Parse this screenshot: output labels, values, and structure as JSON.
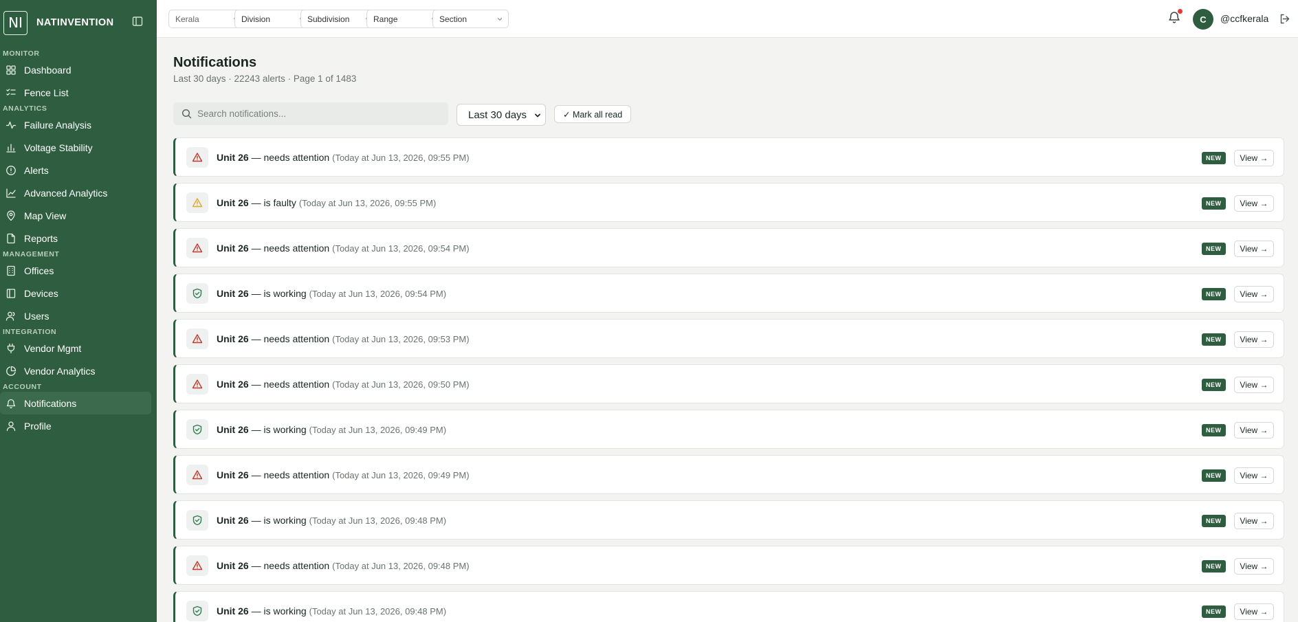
{
  "app": {
    "brand_initials": "NI",
    "brand_name": "NATINVENTION"
  },
  "sidebar": {
    "sections": [
      {
        "label": "MONITOR",
        "items": [
          {
            "label": "Dashboard",
            "icon": "dashboard-icon"
          },
          {
            "label": "Fence List",
            "icon": "list-check-icon"
          }
        ]
      },
      {
        "label": "ANALYTICS",
        "items": [
          {
            "label": "Failure Analysis",
            "icon": "activity-icon"
          },
          {
            "label": "Voltage Stability",
            "icon": "bar-chart-icon"
          },
          {
            "label": "Alerts",
            "icon": "alert-circle-icon"
          },
          {
            "label": "Advanced Analytics",
            "icon": "line-chart-icon"
          },
          {
            "label": "Map View",
            "icon": "map-pin-icon"
          },
          {
            "label": "Reports",
            "icon": "file-icon"
          }
        ]
      },
      {
        "label": "MANAGEMENT",
        "items": [
          {
            "label": "Offices",
            "icon": "building-icon"
          },
          {
            "label": "Devices",
            "icon": "device-icon"
          },
          {
            "label": "Users",
            "icon": "users-icon"
          }
        ]
      },
      {
        "label": "INTEGRATION",
        "items": [
          {
            "label": "Vendor Mgmt",
            "icon": "plug-icon"
          },
          {
            "label": "Vendor Analytics",
            "icon": "pie-chart-icon"
          }
        ]
      },
      {
        "label": "ACCOUNT",
        "items": [
          {
            "label": "Notifications",
            "icon": "bell-icon",
            "active": true
          },
          {
            "label": "Profile",
            "icon": "user-icon"
          }
        ]
      }
    ]
  },
  "topbar": {
    "filters": [
      {
        "label": "Kerala",
        "muted": true
      },
      {
        "label": "Division"
      },
      {
        "label": "Subdivision"
      },
      {
        "label": "Range"
      },
      {
        "label": "Section"
      }
    ],
    "avatar_initial": "C",
    "username": "@ccfkerala"
  },
  "main": {
    "title": "Notifications",
    "subtitle": "Last 30 days · 22243 alerts · Page 1 of 1483",
    "search_placeholder": "Search notifications...",
    "range_selected": "Last 30 days",
    "mark_all_label": "✓ Mark all read"
  },
  "colors": {
    "sidebar": "#2e5e3f",
    "danger": "#c0392b",
    "warning": "#e0a82e",
    "ok": "#2e7d4f"
  },
  "notifications": [
    {
      "unit": "Unit 26",
      "message": "— needs attention",
      "time": "(Today at Jun 13, 2026, 09:55 PM)",
      "kind": "danger",
      "badge": "NEW",
      "action": "View →"
    },
    {
      "unit": "Unit 26",
      "message": "— is faulty",
      "time": "(Today at Jun 13, 2026, 09:55 PM)",
      "kind": "warning",
      "badge": "NEW",
      "action": "View →"
    },
    {
      "unit": "Unit 26",
      "message": "— needs attention",
      "time": "(Today at Jun 13, 2026, 09:54 PM)",
      "kind": "danger",
      "badge": "NEW",
      "action": "View →"
    },
    {
      "unit": "Unit 26",
      "message": "— is working",
      "time": "(Today at Jun 13, 2026, 09:54 PM)",
      "kind": "ok",
      "badge": "NEW",
      "action": "View →"
    },
    {
      "unit": "Unit 26",
      "message": "— needs attention",
      "time": "(Today at Jun 13, 2026, 09:53 PM)",
      "kind": "danger",
      "badge": "NEW",
      "action": "View →"
    },
    {
      "unit": "Unit 26",
      "message": "— needs attention",
      "time": "(Today at Jun 13, 2026, 09:50 PM)",
      "kind": "danger",
      "badge": "NEW",
      "action": "View →"
    },
    {
      "unit": "Unit 26",
      "message": "— is working",
      "time": "(Today at Jun 13, 2026, 09:49 PM)",
      "kind": "ok",
      "badge": "NEW",
      "action": "View →"
    },
    {
      "unit": "Unit 26",
      "message": "— needs attention",
      "time": "(Today at Jun 13, 2026, 09:49 PM)",
      "kind": "danger",
      "badge": "NEW",
      "action": "View →"
    },
    {
      "unit": "Unit 26",
      "message": "— is working",
      "time": "(Today at Jun 13, 2026, 09:48 PM)",
      "kind": "ok",
      "badge": "NEW",
      "action": "View →"
    },
    {
      "unit": "Unit 26",
      "message": "— needs attention",
      "time": "(Today at Jun 13, 2026, 09:48 PM)",
      "kind": "danger",
      "badge": "NEW",
      "action": "View →"
    },
    {
      "unit": "Unit 26",
      "message": "— is working",
      "time": "(Today at Jun 13, 2026, 09:48 PM)",
      "kind": "ok",
      "badge": "NEW",
      "action": "View →"
    }
  ]
}
